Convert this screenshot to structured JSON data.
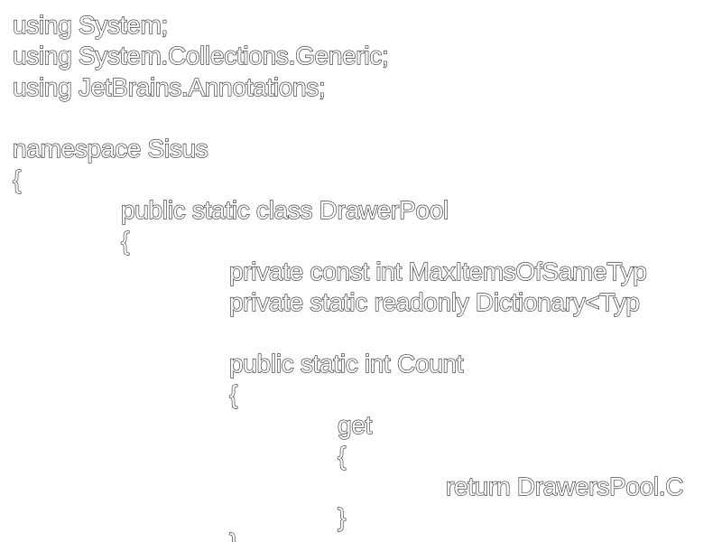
{
  "code": {
    "lines": [
      "using System;",
      "using System.Collections.Generic;",
      "using JetBrains.Annotations;",
      "",
      "namespace Sisus",
      "{",
      "public static class DrawerPool",
      "{",
      "private const int MaxItemsOfSameTyp",
      "private static readonly Dictionary<Typ",
      "",
      "public static int Count",
      "{",
      "get",
      "{",
      "return DrawersPool.C",
      "}",
      "}"
    ]
  }
}
